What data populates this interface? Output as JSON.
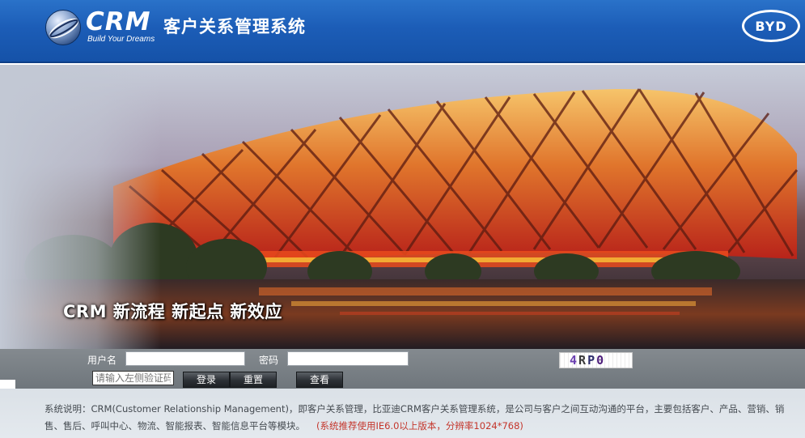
{
  "header": {
    "logo_text": "CRM",
    "logo_slogan": "Build Your Dreams",
    "app_title": "客户关系管理系统",
    "brand_badge": "BYD"
  },
  "banner": {
    "slogan": "CRM 新流程 新起点 新效应"
  },
  "login": {
    "username_label": "用户名",
    "username_value": "",
    "password_label": "密码",
    "password_value": "",
    "captcha_placeholder": "请输入左侧验证码",
    "captcha_chars": [
      "4",
      "R",
      "P",
      "0"
    ],
    "buttons": {
      "login": "登录",
      "reset": "重置",
      "view": "查看"
    }
  },
  "footer": {
    "description": "系统说明：CRM(Customer Relationship Management)，即客户关系管理，比亚迪CRM客户关系管理系统，是公司与客户之间互动沟通的平台，主要包括客户、产品、营销、销售、售后、呼叫中心、物流、智能报表、智能信息平台等模块。",
    "note": "(系统推荐使用IE6.0以上版本，分辨率1024*768)"
  },
  "colors": {
    "header_blue": "#1c5db7",
    "login_bar_gray": "#767d83",
    "footer_bg": "#e0e5ea",
    "note_red": "#c4362c"
  },
  "icons": {
    "logo": "crm-globe-icon",
    "brand": "byd-badge"
  }
}
